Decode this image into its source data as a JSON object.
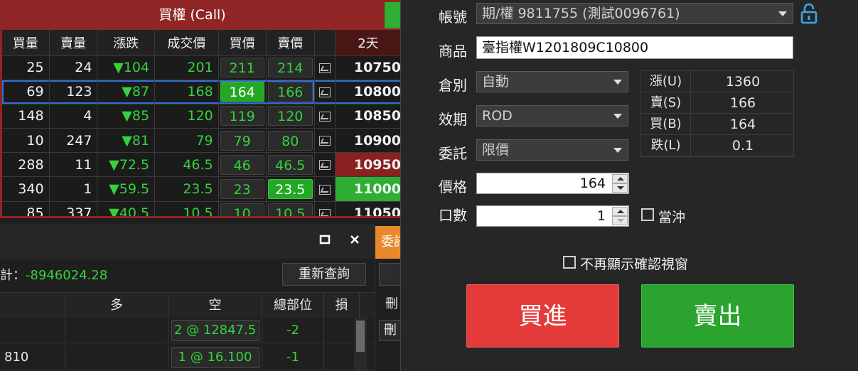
{
  "quote": {
    "header": "買權 (Call)",
    "columns": [
      "買量",
      "賣量",
      "漲跌",
      "成交價",
      "買價",
      "賣價",
      "",
      "2天"
    ],
    "rows": [
      {
        "bid_qty": "25",
        "ask_qty": "24",
        "change": "▼104",
        "last": "201",
        "bid": "211",
        "ask": "214",
        "strike": "10750"
      },
      {
        "bid_qty": "69",
        "ask_qty": "123",
        "change": "▼87",
        "last": "168",
        "bid": "164",
        "ask": "166",
        "strike": "10800"
      },
      {
        "bid_qty": "148",
        "ask_qty": "4",
        "change": "▼85",
        "last": "120",
        "bid": "119",
        "ask": "120",
        "strike": "10850"
      },
      {
        "bid_qty": "10",
        "ask_qty": "247",
        "change": "▼81",
        "last": "79",
        "bid": "79",
        "ask": "80",
        "strike": "10900"
      },
      {
        "bid_qty": "288",
        "ask_qty": "11",
        "change": "▼72.5",
        "last": "46.5",
        "bid": "46",
        "ask": "46.5",
        "strike": "10950"
      },
      {
        "bid_qty": "340",
        "ask_qty": "1",
        "change": "▼59.5",
        "last": "23.5",
        "bid": "23",
        "ask": "23.5",
        "strike": "11000"
      },
      {
        "bid_qty": "85",
        "ask_qty": "337",
        "change": "▼40.5",
        "last": "10.5",
        "bid": "10",
        "ask": "10.5",
        "strike": "11050"
      }
    ]
  },
  "positions": {
    "total_label": "合計：",
    "total_value": "-8946024.28",
    "requery_label": "重新查詢",
    "columns": [
      "",
      "多",
      "空",
      "總部位",
      "損"
    ],
    "rows": [
      {
        "name": "",
        "long": "",
        "short": "2 @ 12847.5",
        "net": "-2"
      },
      {
        "name": "810",
        "long": "",
        "short": "1 @ 16.100",
        "net": "-1"
      }
    ]
  },
  "mid_panel": {
    "tab_label": "委託",
    "header": "刪",
    "row_label": "刪"
  },
  "order": {
    "account_label": "帳號",
    "account_value": "期/權 9811755 (測試0096761)",
    "product_label": "商品",
    "product_value": "臺指權W1201809C10800",
    "position_type_label": "倉別",
    "position_type_value": "自動",
    "validity_label": "效期",
    "validity_value": "ROD",
    "order_type_label": "委託",
    "order_type_value": "限價",
    "price_label": "價格",
    "price_value": "164",
    "qty_label": "口數",
    "qty_value": "1",
    "daytrade_label": "當沖",
    "no_confirm_label": "不再顯示確認視窗",
    "buy_label": "買進",
    "sell_label": "賣出",
    "limits": [
      {
        "key": "漲(U)",
        "value": "1360"
      },
      {
        "key": "賣(S)",
        "value": "166"
      },
      {
        "key": "買(B)",
        "value": "164"
      },
      {
        "key": "跌(L)",
        "value": "0.1"
      }
    ]
  },
  "colors": {
    "call_header": "#8f2525",
    "up_green": "#34d23c",
    "buy_red": "#e53a3a",
    "sell_green": "#2aa42f",
    "tab_orange": "#e88a2a",
    "lock_blue": "#3aa7e8"
  }
}
